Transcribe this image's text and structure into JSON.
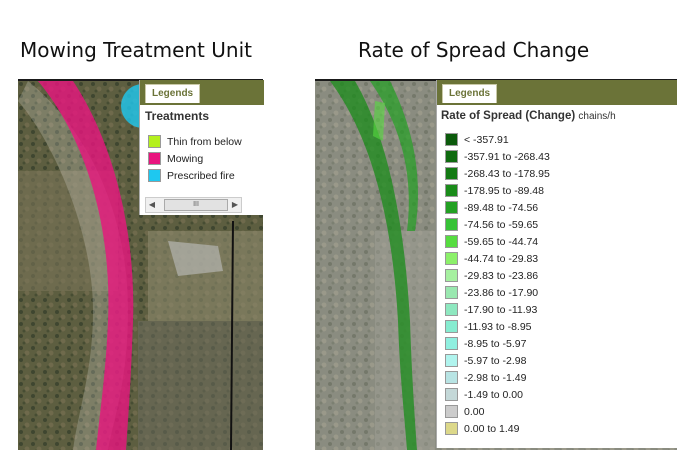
{
  "titles": {
    "left": "Mowing Treatment Unit",
    "right": "Rate of Spread Change"
  },
  "left_panel": {
    "tab_label": "Legends",
    "heading": "Treatments",
    "items": [
      {
        "label": "Thin from below",
        "color": "#b4f01e"
      },
      {
        "label": "Mowing",
        "color": "#e8147e"
      },
      {
        "label": "Prescribed fire",
        "color": "#1ec8f0"
      }
    ],
    "scrollbar_thumb": "III"
  },
  "right_panel": {
    "tab_label": "Legends",
    "heading": "Rate of Spread (Change)",
    "unit": "chains/h",
    "items": [
      {
        "label": "< -357.91",
        "color": "#0b5a0b"
      },
      {
        "label": "-357.91 to -268.43",
        "color": "#0f6a0f"
      },
      {
        "label": "-268.43 to -178.95",
        "color": "#137a13"
      },
      {
        "label": "-178.95 to -89.48",
        "color": "#1a8c1a"
      },
      {
        "label": "-89.48 to -74.56",
        "color": "#22a022"
      },
      {
        "label": "-74.56 to -59.65",
        "color": "#36c236"
      },
      {
        "label": "-59.65 to -44.74",
        "color": "#56dc40"
      },
      {
        "label": "-44.74 to -29.83",
        "color": "#8cf06a"
      },
      {
        "label": "-29.83 to -23.86",
        "color": "#a6f0a0"
      },
      {
        "label": "-23.86 to -17.90",
        "color": "#9ae8b0"
      },
      {
        "label": "-17.90 to -11.93",
        "color": "#8ee8c0"
      },
      {
        "label": "-11.93 to -8.95",
        "color": "#86ecd0"
      },
      {
        "label": "-8.95 to -5.97",
        "color": "#90f0e0"
      },
      {
        "label": "-5.97 to -2.98",
        "color": "#b0f4ee"
      },
      {
        "label": "-2.98 to -1.49",
        "color": "#b8e4e4"
      },
      {
        "label": "-1.49 to 0.00",
        "color": "#c4d8d8"
      },
      {
        "label": "0.00",
        "color": "#cccccc"
      },
      {
        "label": "0.00 to 1.49",
        "color": "#dcd88a"
      }
    ]
  }
}
